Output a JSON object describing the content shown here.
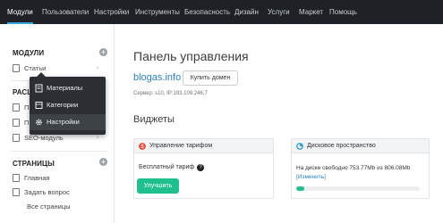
{
  "topnav": {
    "items": [
      "Модули",
      "Пользователи",
      "Настройки",
      "Инструменты",
      "Безопасность",
      "Дизайн",
      "Услуги",
      "Маркет",
      "Помощь"
    ],
    "active_index": 0
  },
  "sidebar": {
    "modules": {
      "title": "МОДУЛИ",
      "items": [
        {
          "label": "Статьи"
        },
        {
          "label": "П"
        },
        {
          "label": "П"
        },
        {
          "label": "SEO-модуль"
        }
      ],
      "hidden_section_title": "РАСШ"
    },
    "pages": {
      "title": "СТРАНИЦЫ",
      "items": [
        {
          "label": "Главная"
        },
        {
          "label": "Задать вопрос"
        },
        {
          "label": "Все страницы"
        }
      ]
    }
  },
  "dropdown": {
    "items": [
      "Материалы",
      "Категории",
      "Настройки"
    ],
    "hover_index": 2
  },
  "main": {
    "title": "Панель управления",
    "domain": "blogas.info",
    "buy_domain_label": "Купить домен",
    "server_info": "Сервер: s10, IP:193.109.246.7",
    "widgets_title": "Виджеты"
  },
  "plan_widget": {
    "title": "Управление тарифом",
    "plan_text": "Бесплатный тариф",
    "help_glyph": "?",
    "upgrade_label": "Улучшить"
  },
  "disk_widget": {
    "title": "Дисковое пространство",
    "info": "На диске свободно 753.77Mb из 806.08Mb",
    "change_link": "[Изменить]",
    "used_fraction": 0.066
  },
  "colors": {
    "topnav_bg": "#1e2226",
    "accent_blue": "#2b82c4",
    "green": "#1fc08e",
    "plan_icon": "#e84b3c",
    "disk_icon": "#2b9fd6"
  },
  "icons": {
    "plus": "+",
    "chevron": "›"
  }
}
